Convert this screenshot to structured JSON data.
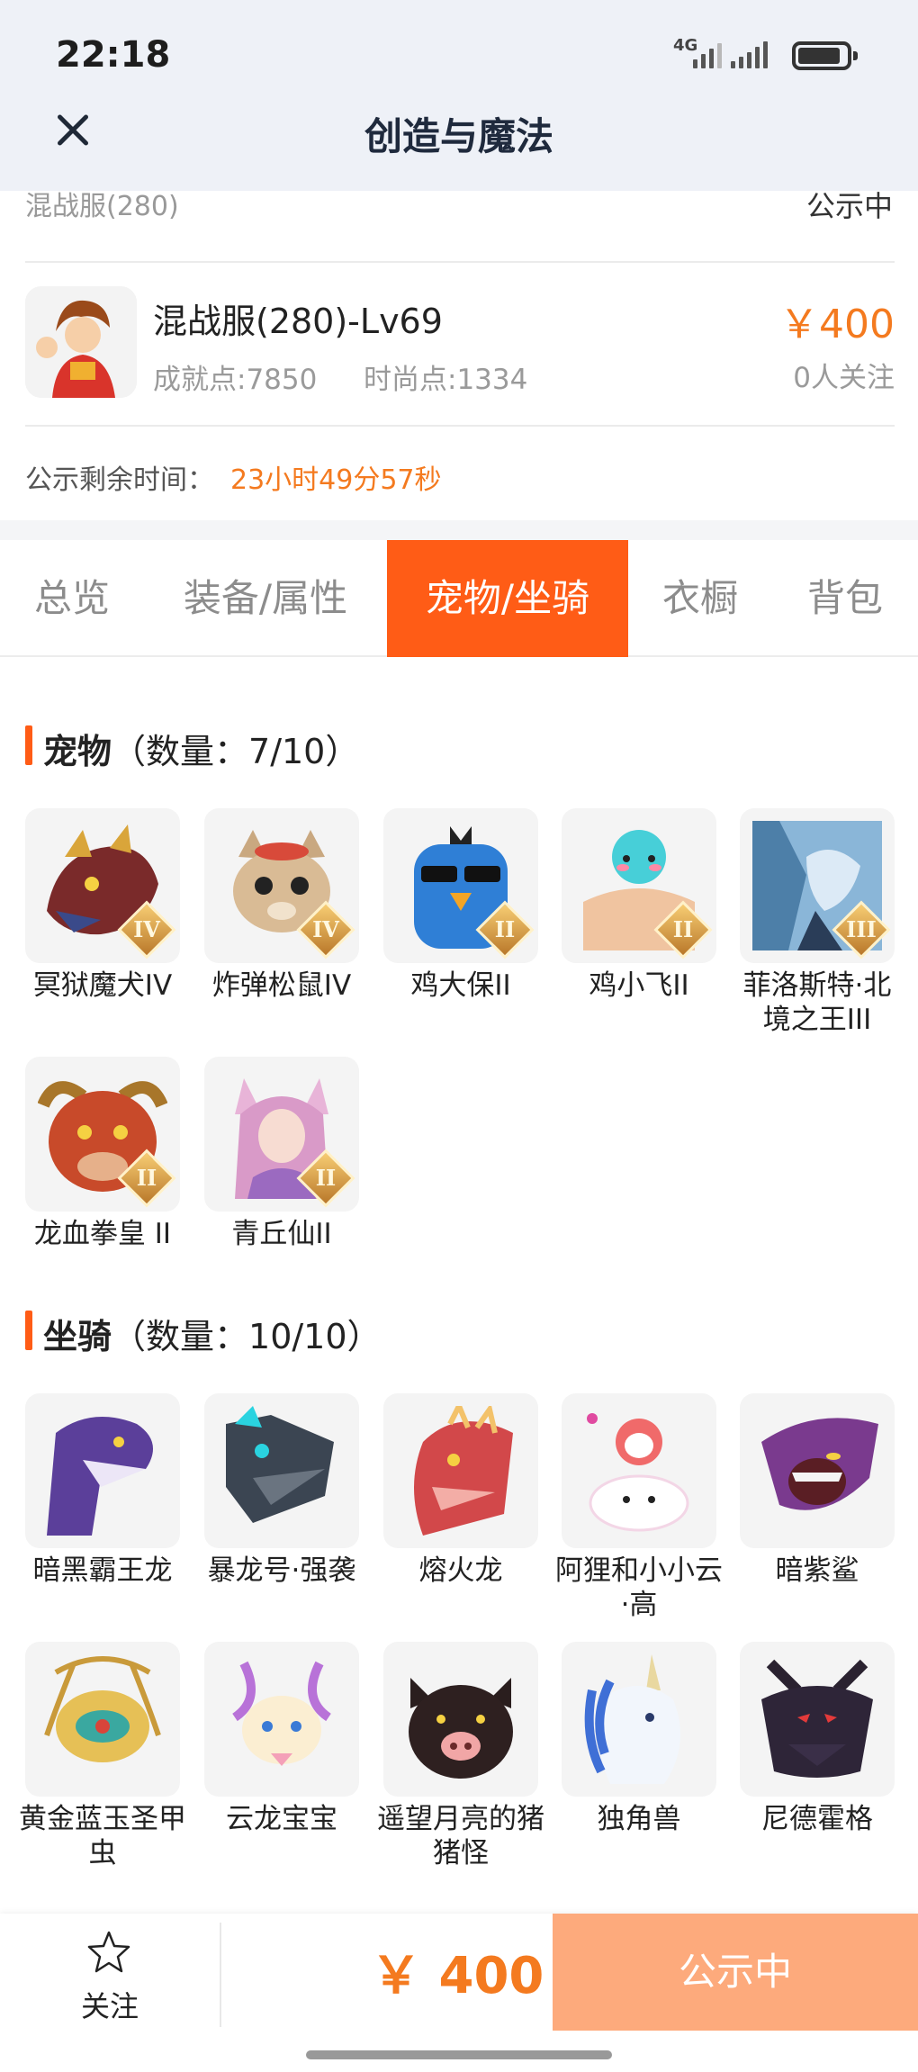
{
  "status_bar": {
    "time": "22:18",
    "network": "4G"
  },
  "nav": {
    "title": "创造与魔法"
  },
  "prev_listing": {
    "server": "混战服(280)",
    "status": "公示中"
  },
  "listing": {
    "server_level": "混战服(280)-Lv69",
    "achievement": "成就点:7850",
    "fashion": "时尚点:1334",
    "price": "￥400",
    "followers": "0人关注",
    "remain_label": "公示剩余时间：",
    "remain_time": "23小时49分57秒"
  },
  "tabs": [
    {
      "label": "总览",
      "active": false
    },
    {
      "label": "装备/属性",
      "active": false
    },
    {
      "label": "宠物/坐骑",
      "active": true
    },
    {
      "label": "衣橱",
      "active": false
    },
    {
      "label": "背包",
      "active": false
    }
  ],
  "pets": {
    "title": "宠物",
    "count": "（数量：7/10）",
    "items": [
      {
        "name": "冥狱魔犬IV",
        "grade": "IV",
        "icon": "hell-hound-icon"
      },
      {
        "name": "炸弹松鼠IV",
        "grade": "IV",
        "icon": "bomb-squirrel-icon"
      },
      {
        "name": "鸡大保II",
        "grade": "II",
        "icon": "blue-bird-icon"
      },
      {
        "name": "鸡小飞II",
        "grade": "II",
        "icon": "cyan-bird-icon"
      },
      {
        "name": "菲洛斯特·北境之王III",
        "grade": "III",
        "icon": "frost-king-icon"
      },
      {
        "name": "龙血拳皇 II",
        "grade": "II",
        "icon": "dragon-fist-icon"
      },
      {
        "name": "青丘仙II",
        "grade": "II",
        "icon": "fox-fairy-icon"
      }
    ]
  },
  "mounts": {
    "title": "坐骑",
    "count": "（数量：10/10）",
    "items": [
      {
        "name": "暗黑霸王龙",
        "icon": "dark-trex-icon"
      },
      {
        "name": "暴龙号·强袭",
        "icon": "mech-dragon-icon"
      },
      {
        "name": "熔火龙",
        "icon": "lava-dragon-icon"
      },
      {
        "name": "阿狸和小小云·高",
        "icon": "ali-cloud-icon"
      },
      {
        "name": "暗紫鲨",
        "icon": "purple-shark-icon"
      },
      {
        "name": "黄金蓝玉圣甲虫",
        "icon": "golden-beetle-icon"
      },
      {
        "name": "云龙宝宝",
        "icon": "cloud-dragon-icon"
      },
      {
        "name": "遥望月亮的猪猪怪",
        "icon": "moon-pig-icon"
      },
      {
        "name": "独角兽",
        "icon": "unicorn-icon"
      },
      {
        "name": "尼德霍格",
        "icon": "nidhogg-icon"
      }
    ]
  },
  "bottom": {
    "follow_label": "关注",
    "price": "￥ 400",
    "status_button": "公示中"
  },
  "colors": {
    "accent": "#ff5c16",
    "price": "#f47a1f",
    "status_button": "#fdaa7c"
  }
}
